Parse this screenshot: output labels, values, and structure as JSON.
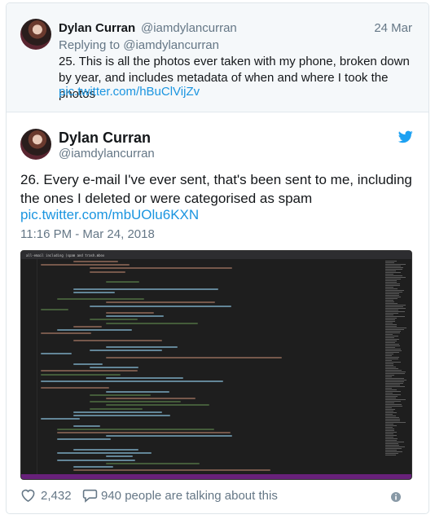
{
  "parent_tweet": {
    "name": "Dylan Curran",
    "handle": "@iamdylancurran",
    "date": "24 Mar",
    "replying_label": "Replying to",
    "replying_handle": "@iamdylancurran",
    "text": "25. This is all the photos ever taken with my phone, broken down by year, and includes metadata of when and where I took the photos",
    "link": "pic.twitter.com/hBuClVijZv"
  },
  "main_tweet": {
    "name": "Dylan Curran",
    "handle": "@iamdylancurran",
    "text": "26. Every e-mail I've ever sent, that's been sent to me, including the ones I deleted or were categorised as spam",
    "link": "pic.twitter.com/mbUOlu6KXN",
    "timestamp": "11:16 PM - Mar 24, 2018",
    "media_title": "all-email including (spam and trash.mbox"
  },
  "actions": {
    "likes": "2,432",
    "talking": "940 people are talking about this"
  },
  "icons": {
    "bird": "twitter-bird-icon",
    "heart": "heart-icon",
    "reply": "comment-icon",
    "info": "info-icon"
  },
  "colors": {
    "link": "#1b95e0",
    "muted": "#657786",
    "bird": "#1da1f2",
    "editor_bg": "#1e1e1e",
    "editor_status": "#68217a"
  }
}
